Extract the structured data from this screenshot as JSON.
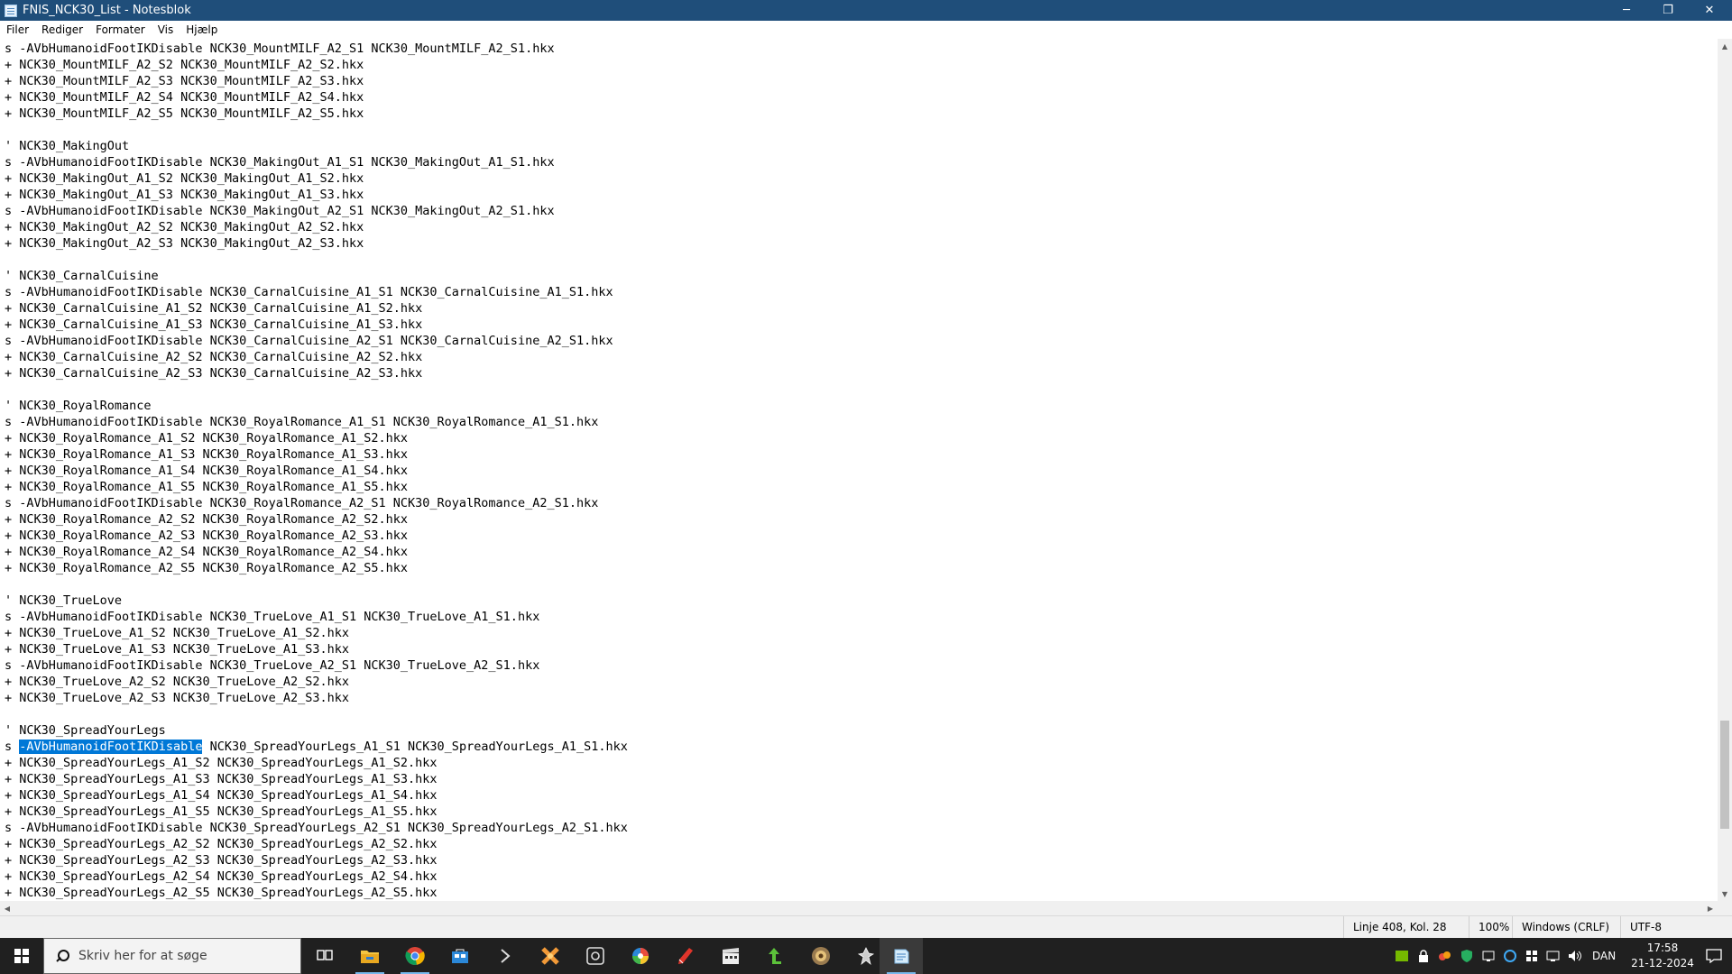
{
  "window": {
    "title": "FNIS_NCK30_List - Notesblok",
    "minimize": "─",
    "restore": "❐",
    "close": "✕"
  },
  "menu": [
    "Filer",
    "Rediger",
    "Formater",
    "Vis",
    "Hjælp"
  ],
  "editor": {
    "lines": [
      "s -AVbHumanoidFootIKDisable NCK30_MountMILF_A2_S1 NCK30_MountMILF_A2_S1.hkx",
      "+ NCK30_MountMILF_A2_S2 NCK30_MountMILF_A2_S2.hkx",
      "+ NCK30_MountMILF_A2_S3 NCK30_MountMILF_A2_S3.hkx",
      "+ NCK30_MountMILF_A2_S4 NCK30_MountMILF_A2_S4.hkx",
      "+ NCK30_MountMILF_A2_S5 NCK30_MountMILF_A2_S5.hkx",
      "",
      "' NCK30_MakingOut",
      "s -AVbHumanoidFootIKDisable NCK30_MakingOut_A1_S1 NCK30_MakingOut_A1_S1.hkx",
      "+ NCK30_MakingOut_A1_S2 NCK30_MakingOut_A1_S2.hkx",
      "+ NCK30_MakingOut_A1_S3 NCK30_MakingOut_A1_S3.hkx",
      "s -AVbHumanoidFootIKDisable NCK30_MakingOut_A2_S1 NCK30_MakingOut_A2_S1.hkx",
      "+ NCK30_MakingOut_A2_S2 NCK30_MakingOut_A2_S2.hkx",
      "+ NCK30_MakingOut_A2_S3 NCK30_MakingOut_A2_S3.hkx",
      "",
      "' NCK30_CarnalCuisine",
      "s -AVbHumanoidFootIKDisable NCK30_CarnalCuisine_A1_S1 NCK30_CarnalCuisine_A1_S1.hkx",
      "+ NCK30_CarnalCuisine_A1_S2 NCK30_CarnalCuisine_A1_S2.hkx",
      "+ NCK30_CarnalCuisine_A1_S3 NCK30_CarnalCuisine_A1_S3.hkx",
      "s -AVbHumanoidFootIKDisable NCK30_CarnalCuisine_A2_S1 NCK30_CarnalCuisine_A2_S1.hkx",
      "+ NCK30_CarnalCuisine_A2_S2 NCK30_CarnalCuisine_A2_S2.hkx",
      "+ NCK30_CarnalCuisine_A2_S3 NCK30_CarnalCuisine_A2_S3.hkx",
      "",
      "' NCK30_RoyalRomance",
      "s -AVbHumanoidFootIKDisable NCK30_RoyalRomance_A1_S1 NCK30_RoyalRomance_A1_S1.hkx",
      "+ NCK30_RoyalRomance_A1_S2 NCK30_RoyalRomance_A1_S2.hkx",
      "+ NCK30_RoyalRomance_A1_S3 NCK30_RoyalRomance_A1_S3.hkx",
      "+ NCK30_RoyalRomance_A1_S4 NCK30_RoyalRomance_A1_S4.hkx",
      "+ NCK30_RoyalRomance_A1_S5 NCK30_RoyalRomance_A1_S5.hkx",
      "s -AVbHumanoidFootIKDisable NCK30_RoyalRomance_A2_S1 NCK30_RoyalRomance_A2_S1.hkx",
      "+ NCK30_RoyalRomance_A2_S2 NCK30_RoyalRomance_A2_S2.hkx",
      "+ NCK30_RoyalRomance_A2_S3 NCK30_RoyalRomance_A2_S3.hkx",
      "+ NCK30_RoyalRomance_A2_S4 NCK30_RoyalRomance_A2_S4.hkx",
      "+ NCK30_RoyalRomance_A2_S5 NCK30_RoyalRomance_A2_S5.hkx",
      "",
      "' NCK30_TrueLove",
      "s -AVbHumanoidFootIKDisable NCK30_TrueLove_A1_S1 NCK30_TrueLove_A1_S1.hkx",
      "+ NCK30_TrueLove_A1_S2 NCK30_TrueLove_A1_S2.hkx",
      "+ NCK30_TrueLove_A1_S3 NCK30_TrueLove_A1_S3.hkx",
      "s -AVbHumanoidFootIKDisable NCK30_TrueLove_A2_S1 NCK30_TrueLove_A2_S1.hkx",
      "+ NCK30_TrueLove_A2_S2 NCK30_TrueLove_A2_S2.hkx",
      "+ NCK30_TrueLove_A2_S3 NCK30_TrueLove_A2_S3.hkx",
      "",
      "' NCK30_SpreadYourLegs",
      "s -AVbHumanoidFootIKDisable NCK30_SpreadYourLegs_A1_S1 NCK30_SpreadYourLegs_A1_S1.hkx",
      "+ NCK30_SpreadYourLegs_A1_S2 NCK30_SpreadYourLegs_A1_S2.hkx",
      "+ NCK30_SpreadYourLegs_A1_S3 NCK30_SpreadYourLegs_A1_S3.hkx",
      "+ NCK30_SpreadYourLegs_A1_S4 NCK30_SpreadYourLegs_A1_S4.hkx",
      "+ NCK30_SpreadYourLegs_A1_S5 NCK30_SpreadYourLegs_A1_S5.hkx",
      "s -AVbHumanoidFootIKDisable NCK30_SpreadYourLegs_A2_S1 NCK30_SpreadYourLegs_A2_S1.hkx",
      "+ NCK30_SpreadYourLegs_A2_S2 NCK30_SpreadYourLegs_A2_S2.hkx",
      "+ NCK30_SpreadYourLegs_A2_S3 NCK30_SpreadYourLegs_A2_S3.hkx",
      "+ NCK30_SpreadYourLegs_A2_S4 NCK30_SpreadYourLegs_A2_S4.hkx",
      "+ NCK30_SpreadYourLegs_A2_S5 NCK30_SpreadYourLegs_A2_S5.hkx"
    ],
    "selection": {
      "line": 43,
      "text": "-AVbHumanoidFootIKDisable"
    },
    "scroll_position": 0.92
  },
  "statusbar": {
    "position": "Linje 408, Kol. 28",
    "zoom": "100%",
    "line_ending": "Windows (CRLF)",
    "encoding": "UTF-8"
  },
  "taskbar": {
    "search_placeholder": "Skriv her for at søge",
    "apps": [
      {
        "icon": "task-view-icon",
        "running": false
      },
      {
        "icon": "file-explorer-icon",
        "running": true
      },
      {
        "icon": "chrome-icon",
        "running": true
      },
      {
        "icon": "store-icon",
        "running": false
      },
      {
        "icon": "terminal-icon",
        "running": false
      },
      {
        "icon": "puzzle-app-icon",
        "running": false
      },
      {
        "icon": "steam-icon",
        "running": false
      },
      {
        "icon": "paint-palette-icon",
        "running": false
      },
      {
        "icon": "pen-app-icon",
        "running": false
      },
      {
        "icon": "clapper-app-icon",
        "running": false
      },
      {
        "icon": "green-arrow-app-icon",
        "running": false
      },
      {
        "icon": "orb-app-icon",
        "running": false
      },
      {
        "icon": "game-figure-app-icon",
        "running": false
      },
      {
        "icon": "notepad-icon",
        "running": true
      }
    ],
    "language": "DAN",
    "time": "17:58",
    "date": "21-12-2024"
  },
  "colors": {
    "titlebar": "#1f4e7a",
    "selection": "#0078d7",
    "taskbar": "#202020"
  }
}
